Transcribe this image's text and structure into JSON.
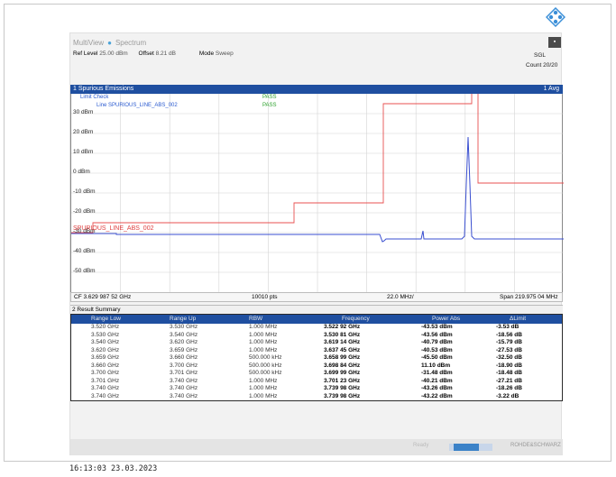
{
  "header": {
    "tabs": [
      "MultiView",
      "Spectrum"
    ],
    "ref_level_label": "Ref Level",
    "ref_level_value": "25.00 dBm",
    "offset_label": "Offset",
    "offset_value": "8.21 dB",
    "mode_label": "Mode",
    "mode_value": "Sweep",
    "sgl": "SGL",
    "count": "Count 20/20",
    "sweep_button": "▪"
  },
  "window1": {
    "title": "1 Spurious Emissions",
    "trace_label": "1 Avg",
    "limit_check_label": "Limit Check",
    "limit_name_top": "Line  SPURIOUS_LINE_ABS_002",
    "pass1": "PASS",
    "pass2": "PASS",
    "limit_line_label": "SPURIOUS_LINE_ABS_002",
    "y_labels": [
      "30 dBm",
      "20 dBm",
      "10 dBm",
      "0 dBm",
      "-10 dBm",
      "-20 dBm",
      "-30 dBm",
      "-40 dBm",
      "-50 dBm"
    ],
    "footer": {
      "cf": "CF 3.629 987 52 GHz",
      "pts": "10010 pts",
      "div": "22.0 MHz/",
      "span": "Span 219.975 04 MHz"
    }
  },
  "window2": {
    "title": "2 Result Summary",
    "columns": [
      "Range Low",
      "Range Up",
      "RBW",
      "Frequency",
      "Power Abs",
      "ΔLimit"
    ],
    "rows": [
      [
        "3.520 GHz",
        "3.530 GHz",
        "1.000 MHz",
        "3.522 92 GHz",
        "-43.53 dBm",
        "-3.53 dB"
      ],
      [
        "3.530 GHz",
        "3.540 GHz",
        "1.000 MHz",
        "3.530 81 GHz",
        "-43.56 dBm",
        "-18.56 dB"
      ],
      [
        "3.540 GHz",
        "3.620 GHz",
        "1.000 MHz",
        "3.619 14 GHz",
        "-40.79 dBm",
        "-15.79 dB"
      ],
      [
        "3.620 GHz",
        "3.659 GHz",
        "1.000 MHz",
        "3.637 45 GHz",
        "-40.53 dBm",
        "-27.53 dB"
      ],
      [
        "3.659 GHz",
        "3.660 GHz",
        "500.000 kHz",
        "3.658 99 GHz",
        "-45.50 dBm",
        "-32.50 dB"
      ],
      [
        "3.660 GHz",
        "3.700 GHz",
        "500.000 kHz",
        "3.698 84 GHz",
        "11.10 dBm",
        "-18.90 dB"
      ],
      [
        "3.700 GHz",
        "3.701 GHz",
        "500.000 kHz",
        "3.699 99 GHz",
        "-31.48 dBm",
        "-18.48 dB"
      ],
      [
        "3.701 GHz",
        "3.740 GHz",
        "1.000 MHz",
        "3.701 23 GHz",
        "-40.21 dBm",
        "-27.21 dB"
      ],
      [
        "3.740 GHz",
        "3.740 GHz",
        "1.000 MHz",
        "3.739 98 GHz",
        "-43.26 dBm",
        "-18.26 dB"
      ],
      [
        "3.740 GHz",
        "3.740 GHz",
        "1.000 MHz",
        "3.739 98 GHz",
        "-43.22 dBm",
        "-3.22 dB"
      ]
    ]
  },
  "status": {
    "ready": "Ready",
    "progress_fraction": 0.7,
    "brand": "ROHDE&SCHWARZ"
  },
  "timestamp": "16:13:03  23.03.2023",
  "colors": {
    "title_bar": "#1f4fa0",
    "trace": "#3a4fd0",
    "limit": "#e85050",
    "pass": "#2aa02a"
  }
}
